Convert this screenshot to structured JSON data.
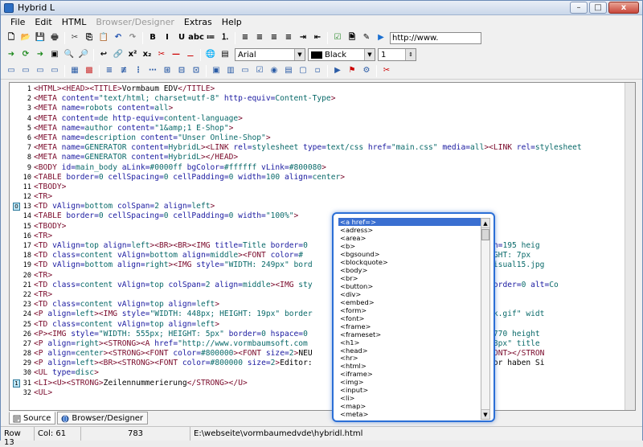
{
  "window": {
    "title": "Hybrid L",
    "btn_min": "–",
    "btn_max": "□",
    "btn_close": "x"
  },
  "menu": [
    "File",
    "Edit",
    "HTML",
    "Browser/Designer",
    "Extras",
    "Help"
  ],
  "toolbar": {
    "url_value": "http://www.",
    "font_value": "Arial",
    "color_value": "Black",
    "size_value": "1"
  },
  "icons": {
    "tb1": [
      "new-file-icon",
      "open-folder-icon",
      "save-icon",
      "print-icon",
      "cut-icon",
      "copy-icon",
      "paste-icon",
      "undo-icon",
      "redo-icon",
      "bold-icon",
      "italic-icon",
      "underline-icon",
      "strikethrough-icon",
      "unordered-list-icon",
      "ordered-list-icon",
      "align-left-icon",
      "align-center-icon",
      "align-justify-icon",
      "align-right-icon",
      "indent-icon",
      "outdent-icon",
      "check-icon",
      "document-icon",
      "pen-icon",
      "play-icon"
    ],
    "tb1_glyphs": [
      "🗋",
      "📂",
      "💾",
      "🖶",
      "✂",
      "⎘",
      "📋",
      "↶",
      "↷",
      "B",
      "I",
      "U",
      "abc",
      "≔",
      "⒈",
      "≡",
      "≡",
      "≡",
      "≡",
      "⇥",
      "⇤",
      "☑",
      "🗎",
      "✎",
      "▶"
    ],
    "tb2": [
      "forward-icon",
      "refresh-icon",
      "back-icon",
      "browse-icon",
      "search-icon",
      "find-icon",
      "arrow-left-icon",
      "link-icon",
      "superscript-icon",
      "subscript-icon",
      "strip-icon",
      "line-icon",
      "text-color-icon",
      "globe-icon",
      "list-icon"
    ],
    "tb2_glyphs": [
      "➜",
      "⟳",
      "➜",
      "▣",
      "🔍",
      "🔎",
      "↩",
      "🔗",
      "x²",
      "x₂",
      "✂",
      "—",
      "⚊",
      "🌐",
      "▤"
    ],
    "tb3": [
      "layout-1-icon",
      "layout-2-icon",
      "layout-3-icon",
      "layout-4-icon",
      "table-icon",
      "table-delete-icon",
      "row-insert-icon",
      "row-delete-icon",
      "col-insert-icon",
      "col-delete-icon",
      "cell-merge-icon",
      "cell-split-icon",
      "cell-props-icon",
      "image-icon",
      "form-icon",
      "textbox-icon",
      "checkbox-icon",
      "radio-icon",
      "select-icon",
      "button-icon",
      "hidden-icon",
      "media-icon",
      "flash-icon",
      "script-icon",
      "link-break-icon"
    ],
    "tb3_glyphs": [
      "▭",
      "▭",
      "▭",
      "▭",
      "▦",
      "▩",
      "≡",
      "≢",
      "⋮",
      "⋯",
      "⊞",
      "⊟",
      "⊡",
      "▣",
      "▥",
      "▭",
      "☑",
      "◉",
      "▤",
      "▢",
      "▫",
      "▶",
      "⚑",
      "⚙",
      "✂"
    ]
  },
  "code_lines": [
    {
      "n": "1",
      "t": "<HTML><HEAD><TITLE>Vormbaum EDV</TITLE>"
    },
    {
      "n": "2",
      "t": "<META content=\"text/html; charset=utf-8\" http-equiv=Content-Type>"
    },
    {
      "n": "3",
      "t": "<META name=robots content=all>"
    },
    {
      "n": "4",
      "t": "<META content=de http-equiv=content-language>"
    },
    {
      "n": "5",
      "t": "<META name=author content=\"1&amp;1 E-Shop\">"
    },
    {
      "n": "6",
      "t": "<META name=description content=\"Unser Online-Shop\">"
    },
    {
      "n": "7",
      "t": "<META name=GENERATOR content=HybridL><LINK rel=stylesheet type=text/css href=\"main.css\" media=all><LINK rel=stylesheet"
    },
    {
      "n": "8",
      "t": "<META name=GENERATOR content=HybridL></HEAD>"
    },
    {
      "n": "9",
      "t": "<BODY id=main_body aLink=#0000ff bgColor=#ffffff vLink=#800080>"
    },
    {
      "n": "10",
      "t": "<TABLE border=0 cellSpacing=0 cellPadding=0 width=100 align=center>"
    },
    {
      "n": "11",
      "t": "<TBODY>"
    },
    {
      "n": "12",
      "t": "<TR>"
    },
    {
      "n": "13",
      "t": "<TD vAlign=bottom colSpan=2 align=left>"
    },
    {
      "n": "14",
      "t": "<TABLE border=0 cellSpacing=0 cellPadding=0 width=\"100%\">"
    },
    {
      "n": "15",
      "t": "<TBODY>"
    },
    {
      "n": "16",
      "t": "<TR>"
    },
    {
      "n": "17",
      "t": "<TD vAlign=top align=left><BR><BR><IMG title=Title border=0                         neu200.png\" width=195 heig"
    },
    {
      "n": "18",
      "t": "<TD class=content vAlign=bottom align=middle><FONT color=#                         IDTH: 549px; HEIGHT: 7px\""
    },
    {
      "n": "19",
      "t": "<TD vAlign=bottom align=right><IMG style=\"WIDTH: 249px\" bord                        resources/key_visual15.jpg\""
    },
    {
      "n": "20",
      "t": "<TR>"
    },
    {
      "n": "21",
      "t": "<TD class=content vAlign=top colSpan=2 align=middle><IMG sty                          title=Title border=0 alt=Co"
    },
    {
      "n": "22",
      "t": "<TR>"
    },
    {
      "n": "23",
      "t": "<TD class=content vAlign=top align=left>"
    },
    {
      "n": "24",
      "t": "<P align=left><IMG style=\"WIDTH: 448px; HEIGHT: 19px\" border                        \"resources/blank.gif\" widt"
    },
    {
      "n": "25",
      "t": "<TD class=content vAlign=top align=left>"
    },
    {
      "n": "26",
      "t": "<P><IMG style=\"WIDTH: 555px; HEIGHT: 5px\" border=0 hspace=0                         lank.gif\" width=770 height"
    },
    {
      "n": "27",
      "t": "<P align=right><STRONG><A href=\"http://www.vormbaumsoft.com                         30px; HEIGHT: 18px\" title"
    },
    {
      "n": "28",
      "t": "<P align=center><STRONG><FONT color=#800000><FONT size=2>NEU                         </P></FONT></FONT></STRON"
    },
    {
      "n": "29",
      "t": "<P align=left><BR><STRONG><FONT color=#800000 size=2>Editor:                         Quellcode-Editor haben Si"
    },
    {
      "n": "30",
      "t": "<UL type=disc>"
    },
    {
      "n": "31",
      "t": "<LI><U><STRONG>Zeilennummerierung</STRONG></U>"
    },
    {
      "n": "32",
      "t": "<UL>"
    }
  ],
  "bookmarks": [
    {
      "label": "0",
      "line": "13"
    },
    {
      "label": "1",
      "line": "31"
    }
  ],
  "popup_items": [
    "<a href=>",
    "<adress>",
    "<area>",
    "<b>",
    "<bgsound>",
    "<blockquote>",
    "<body>",
    "<br>",
    "<button>",
    "<div>",
    "<embed>",
    "<form>",
    "<font>",
    "<frame>",
    "<frameset>",
    "<h1>",
    "<head>",
    "<hr>",
    "<html>",
    "<iframe>",
    "<img>",
    "<input>",
    "<li>",
    "<map>",
    "<meta>"
  ],
  "popup_selected": "<a href=>",
  "tabs": [
    {
      "label": "Source",
      "active": true
    },
    {
      "label": "Browser/Designer",
      "active": false
    }
  ],
  "status": {
    "row": "Row 13",
    "col": "Col: 61",
    "count": "783",
    "path": "E:\\webseite\\vormbaumedvde\\hybridl.html"
  },
  "colors": {
    "tag": "#7a0a2b",
    "attr": "#1a1aa0",
    "value": "#0a6a6a",
    "selection": "#3a6fd1",
    "popup_border": "#2b6fd6"
  }
}
